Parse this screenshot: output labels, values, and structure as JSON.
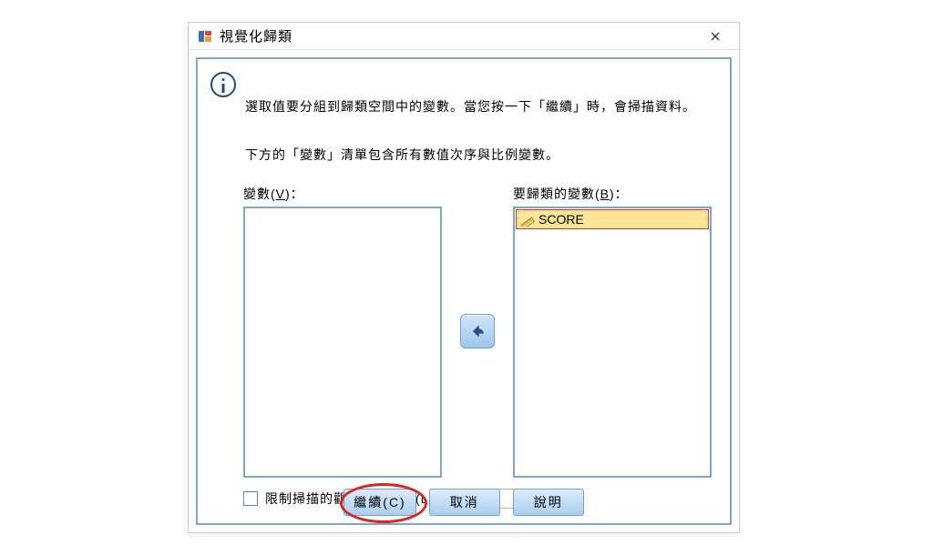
{
  "window": {
    "title": "視覺化歸類"
  },
  "info": {
    "line1": "選取值要分組到歸類空間中的變數。當您按一下「繼續」時，會掃描資料。",
    "line2": "下方的「變數」清單包含所有數值次序與比例變數。"
  },
  "labels": {
    "variables_prefix": "變數(",
    "variables_hotkey": "V",
    "variables_suffix": ")：",
    "target_prefix": "要歸類的變數(",
    "target_hotkey": "B",
    "target_suffix": ")：",
    "limit_prefix": "限制掃描的觀察值數目為(",
    "limit_hotkey": "L",
    "limit_suffix": ")："
  },
  "right_list": {
    "items": [
      {
        "name": "SCORE"
      }
    ]
  },
  "limit": {
    "checked": false,
    "value": ""
  },
  "buttons": {
    "continue": "繼續(C)",
    "cancel": "取消",
    "help": "說明"
  }
}
